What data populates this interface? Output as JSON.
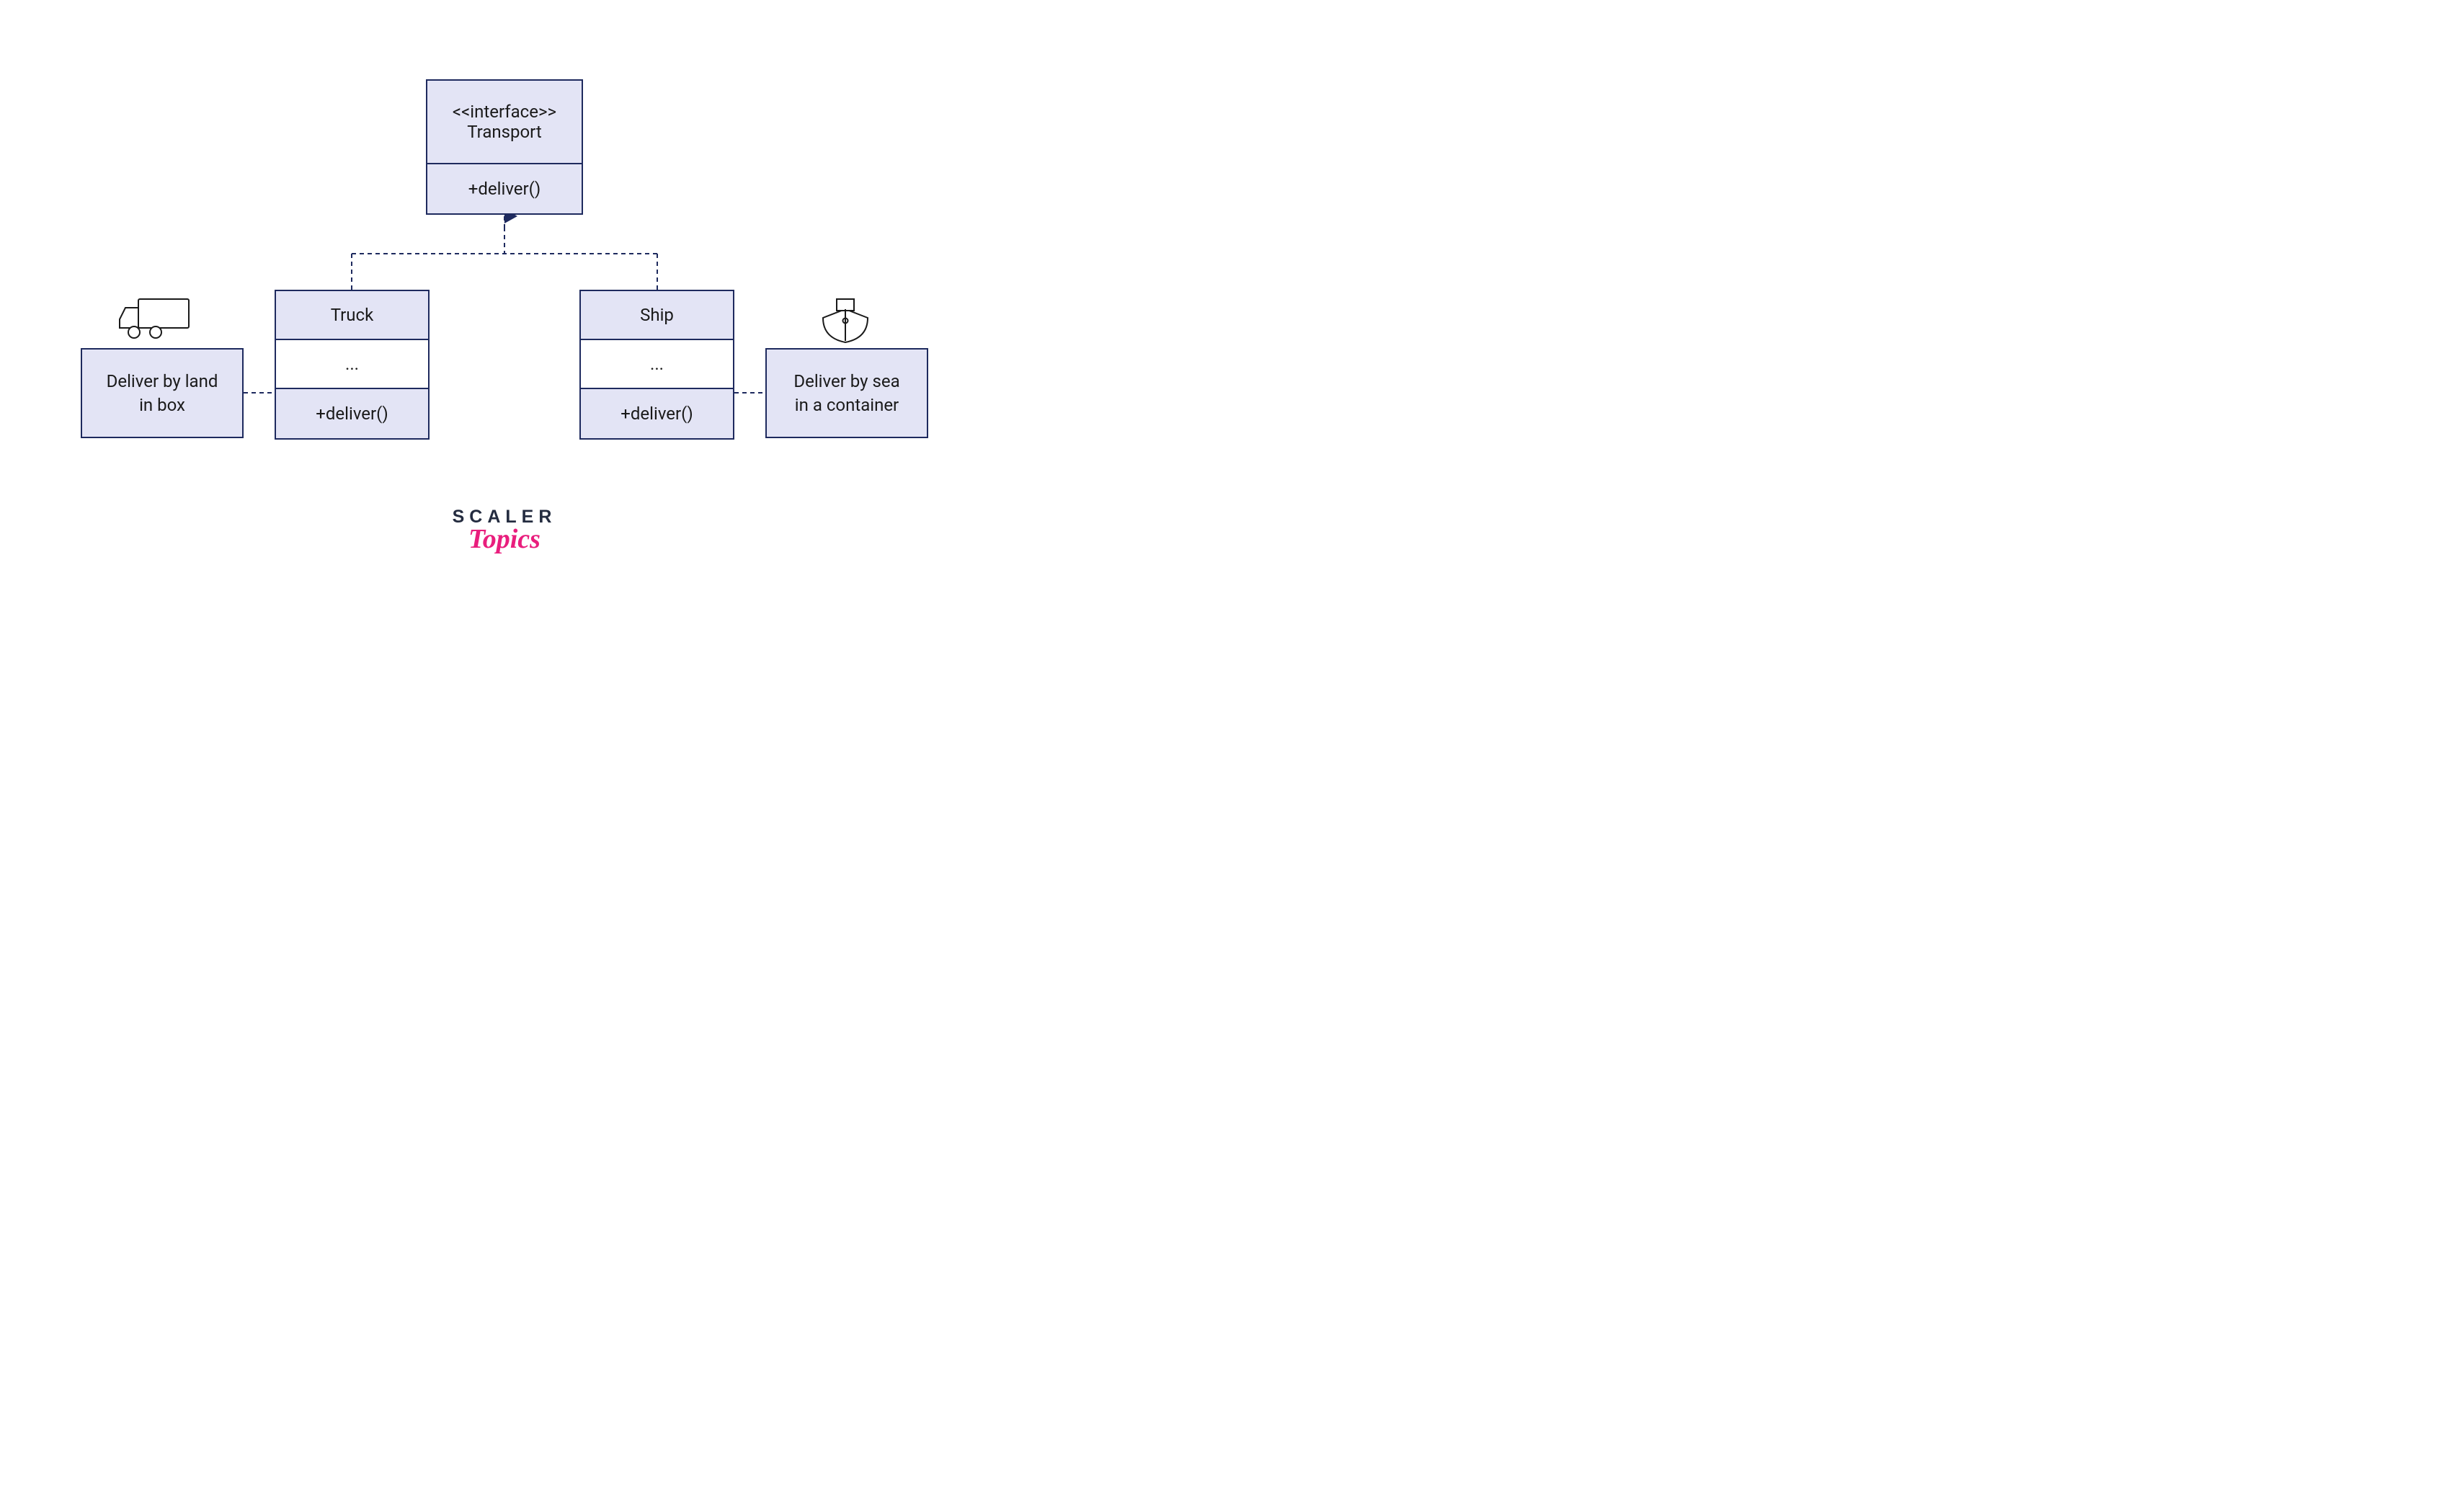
{
  "interface": {
    "stereotype": "<<interface>>",
    "name": "Transport",
    "method": "+deliver()"
  },
  "truck": {
    "name": "Truck",
    "mid": "...",
    "method": "+deliver()",
    "note_l1": "Deliver by land",
    "note_l2": "in box"
  },
  "ship": {
    "name": "Ship",
    "mid": "...",
    "method": "+deliver()",
    "note_l1": "Deliver by sea",
    "note_l2": "in a container"
  },
  "logo": {
    "top": "SCALER",
    "bottom": "Topics"
  },
  "colors": {
    "box_border": "#1e2a5e",
    "box_fill": "#e3e4f5",
    "logo_dark": "#242c40",
    "logo_pink": "#e91e7d"
  }
}
